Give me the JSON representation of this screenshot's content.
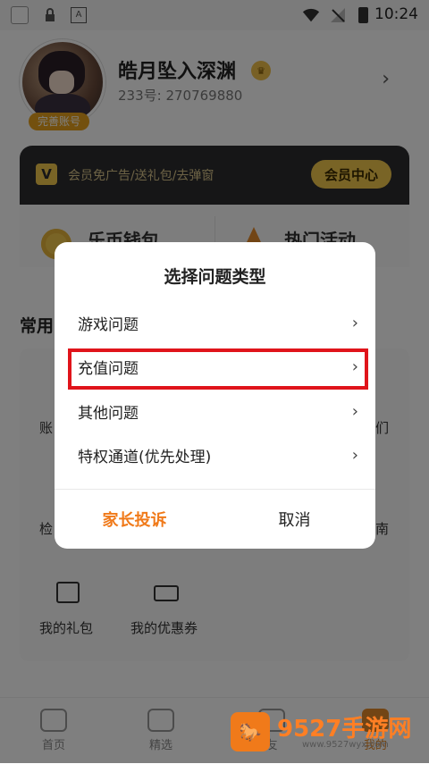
{
  "status_bar": {
    "time": "10:24",
    "icons": [
      "app-square-icon",
      "lock-icon",
      "keyboard-icon",
      "wifi-icon",
      "no-signal-icon",
      "battery-charging-icon"
    ]
  },
  "profile": {
    "nickname": "皓月坠入深渊",
    "uid": "233号: 270769880",
    "badge": "完善账号",
    "arrow": "›"
  },
  "vip": {
    "logo": "V",
    "text": "会员免广告/送礼包/去弹窗",
    "button": "会员中心"
  },
  "wallet": {
    "label": "乐币钱包"
  },
  "events": {
    "label": "热门活动"
  },
  "common": {
    "title_visible": "常用",
    "row1_left": "账",
    "row1_right": "们",
    "row2_left": "检",
    "row2_right": "南",
    "gift_label": "我的礼包",
    "coupon_label": "我的优惠券"
  },
  "bottom_nav": {
    "items": [
      {
        "label": "首页"
      },
      {
        "label": "精选"
      },
      {
        "label": "友"
      },
      {
        "label": "我的"
      }
    ]
  },
  "dialog": {
    "title": "选择问题类型",
    "items": [
      {
        "label": "游戏问题"
      },
      {
        "label": "充值问题"
      },
      {
        "label": "其他问题"
      },
      {
        "label": "特权通道(优先处理)"
      }
    ],
    "chevron": "›",
    "parent_complaint": "家长投诉",
    "cancel": "取消",
    "colors": {
      "complaint": "#f07a1a",
      "highlight": "#e0141b"
    }
  },
  "watermark": {
    "logo": "🐎",
    "text": "9527手游网",
    "url": "www.9527wyx.com"
  }
}
